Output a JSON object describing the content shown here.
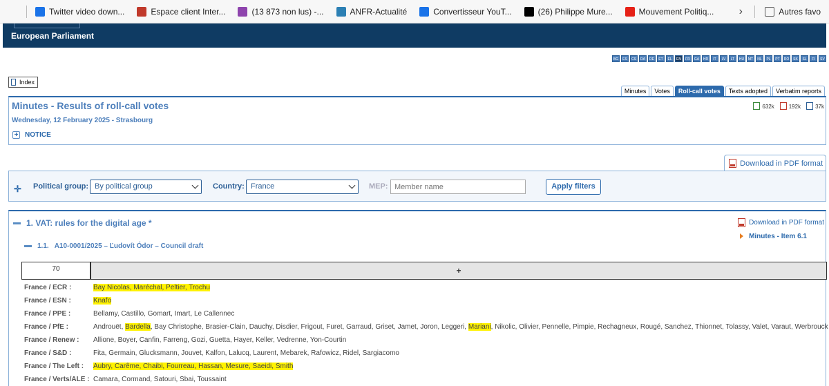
{
  "bookmarks": [
    {
      "label": "Twitter video down...",
      "icon": "layers-icon",
      "color": "#1a73e8"
    },
    {
      "label": "Espace client Inter...",
      "icon": "flag-icon",
      "color": "#c0392b"
    },
    {
      "label": "(13 873 non lus) -...",
      "icon": "mail-icon",
      "color": "#8e44ad"
    },
    {
      "label": "ANFR-Actualité",
      "icon": "antenna-icon",
      "color": "#2c80b4"
    },
    {
      "label": "Convertisseur YouT...",
      "icon": "infinity-icon",
      "color": "#1a73e8"
    },
    {
      "label": "(26) Philippe Mure...",
      "icon": "x-icon",
      "color": "#000000"
    },
    {
      "label": "Mouvement Politiq...",
      "icon": "youtube-icon",
      "color": "#e62117"
    }
  ],
  "bookmarks_other": "Autres favo",
  "header": {
    "site_name": "European Parliament"
  },
  "languages": [
    "BG",
    "ES",
    "CS",
    "DA",
    "DE",
    "ET",
    "EL",
    "EN",
    "FR",
    "GA",
    "HR",
    "IT",
    "LV",
    "LT",
    "HU",
    "MT",
    "NL",
    "PL",
    "PT",
    "RO",
    "SK",
    "SL",
    "FI",
    "SV"
  ],
  "active_language": "EN",
  "index_label": "Index",
  "tabs": [
    "Minutes",
    "Votes",
    "Roll-call votes",
    "Texts adopted",
    "Verbatim reports"
  ],
  "active_tab": "Roll-call votes",
  "page": {
    "title": "Minutes - Results of roll-call votes",
    "subtitle": "Wednesday, 12 February 2025 - Strasbourg",
    "notice": "NOTICE",
    "formats": [
      {
        "type": "xml",
        "size": "632k"
      },
      {
        "type": "pdf",
        "size": "192k"
      },
      {
        "type": "doc",
        "size": "37k"
      }
    ]
  },
  "download_pdf_label": "Download in PDF format",
  "filters": {
    "political_group_label": "Political group:",
    "political_group_value": "By political group",
    "country_label": "Country:",
    "country_value": "France",
    "mep_label": "MEP:",
    "mep_placeholder": "Member name",
    "apply_label": "Apply filters"
  },
  "item": {
    "title": "1. VAT: rules for the digital age *",
    "sub_number": "1.1.",
    "sub_title": "A10-0001/2025 – Ľudovít Ódor – Council draft",
    "download_label": "Download in PDF format",
    "minutes_link": "Minutes - Item 6.1",
    "count": "70",
    "result_symbol": "+"
  },
  "votes": [
    {
      "group": "France / ECR :",
      "names": [
        [
          "Bay Nicolas, Maréchal, Peltier, Trochu",
          true
        ]
      ]
    },
    {
      "group": "France / ESN :",
      "names": [
        [
          "Knafo",
          true
        ]
      ]
    },
    {
      "group": "France / PPE :",
      "names": [
        [
          "Bellamy, Castillo, Gomart, Imart, Le Callennec",
          false
        ]
      ]
    },
    {
      "group": "France / PfE :",
      "names": [
        [
          "Androuët, ",
          false
        ],
        [
          "Bardella",
          true
        ],
        [
          ", Bay Christophe, Brasier-Clain, Dauchy, Disdier, Frigout, Furet, Garraud, Griset, Jamet, Joron, Leggeri, ",
          false
        ],
        [
          "Mariani",
          true
        ],
        [
          ", Nikolic, Olivier, Pennelle, Pimpie, Rechagneux, Rougé, Sanchez, Thionnet, Tolassy, Valet, Varaut, Werbrouck",
          false
        ]
      ]
    },
    {
      "group": "France / Renew :",
      "names": [
        [
          "Allione, Boyer, Canfin, Farreng, Gozi, Guetta, Hayer, Keller, Vedrenne, Yon-Courtin",
          false
        ]
      ]
    },
    {
      "group": "France / S&D :",
      "names": [
        [
          "Fita, Germain, Glucksmann, Jouvet, Kalfon, Lalucq, Laurent, Mebarek, Rafowicz, Ridel, Sargiacomo",
          false
        ]
      ]
    },
    {
      "group": "France / The Left :",
      "names": [
        [
          "Aubry, Carême, Chaibi, Fourreau, Hassan, Mesure, Saeidi, Smith",
          true
        ]
      ]
    },
    {
      "group": "France / Verts/ALE :",
      "names": [
        [
          "Camara, Cormand, Satouri, Sbai, Toussaint",
          false
        ]
      ]
    }
  ]
}
